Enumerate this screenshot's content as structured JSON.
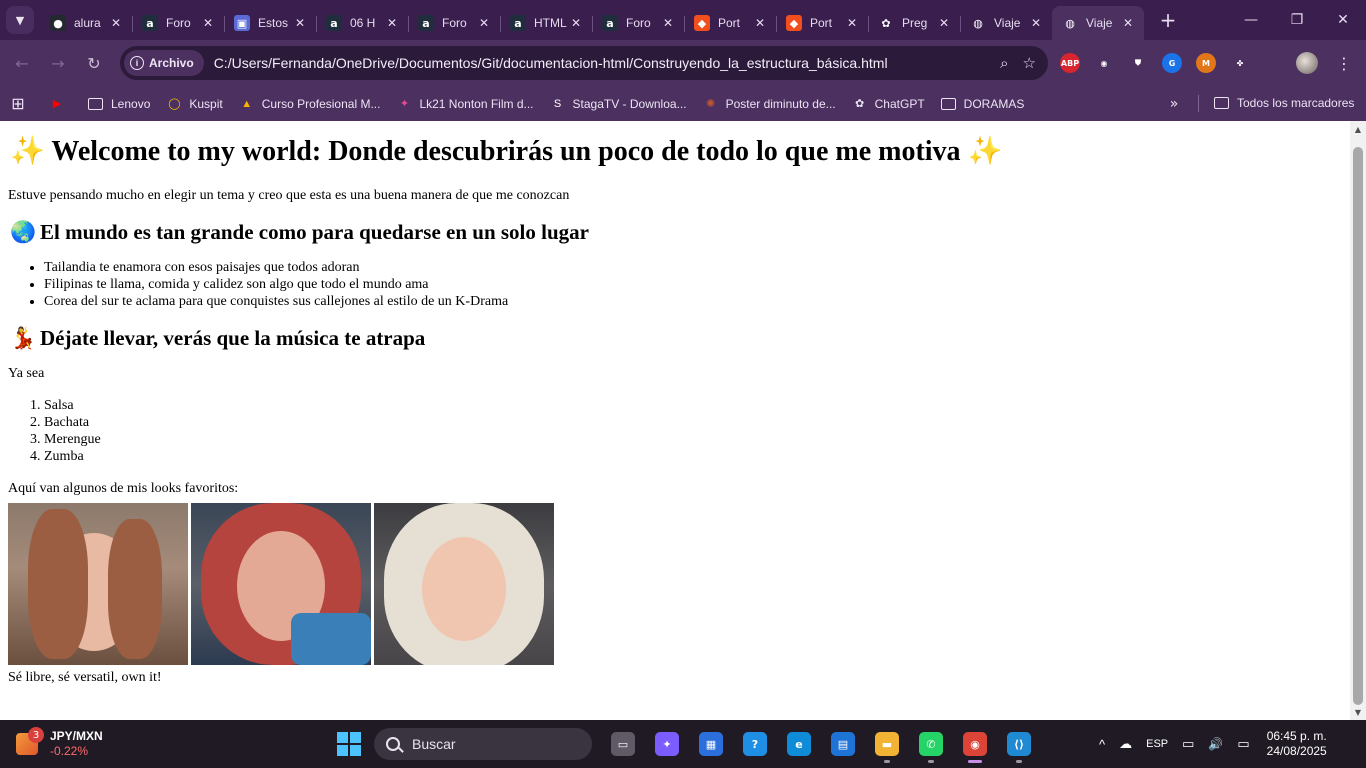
{
  "browser": {
    "tab_search_icon": "chevron-down-icon",
    "tabs": [
      {
        "title": "alura",
        "favicon": "github-icon",
        "color": "#24292f",
        "glyph": "●"
      },
      {
        "title": "Foro",
        "favicon": "alura-icon",
        "color": "#1f2d3d",
        "glyph": "a"
      },
      {
        "title": "Estos",
        "favicon": "image-icon",
        "color": "#5b6bd6",
        "glyph": "▣"
      },
      {
        "title": "06 H",
        "favicon": "alura-icon",
        "color": "#1f2d3d",
        "glyph": "a"
      },
      {
        "title": "Foro",
        "favicon": "alura-icon",
        "color": "#1f2d3d",
        "glyph": "a"
      },
      {
        "title": "HTML",
        "favicon": "alura-icon",
        "color": "#1f2d3d",
        "glyph": "a"
      },
      {
        "title": "Foro",
        "favicon": "alura-icon",
        "color": "#1f2d3d",
        "glyph": "a"
      },
      {
        "title": "Port",
        "favicon": "figma-icon",
        "color": "#f24e1e",
        "glyph": "◆"
      },
      {
        "title": "Port",
        "favicon": "figma-icon",
        "color": "#f24e1e",
        "glyph": "◆"
      },
      {
        "title": "Preg",
        "favicon": "chatgpt-icon",
        "color": "#3a1e4e",
        "glyph": "✿"
      },
      {
        "title": "Viaje",
        "favicon": "globe-icon",
        "color": "#3a1e4e",
        "glyph": "◍"
      },
      {
        "title": "Viaje",
        "favicon": "globe-icon",
        "color": "#4b3060",
        "glyph": "◍",
        "active": true
      }
    ],
    "close_glyph": "✕",
    "new_tab_glyph": "+",
    "window_controls": {
      "minimize": "—",
      "maximize": "❐",
      "close": "✕"
    },
    "nav": {
      "back": "←",
      "forward": "→",
      "reload": "↻"
    },
    "omnibox": {
      "chip_label": "Archivo",
      "chip_icon": "i",
      "url": "C:/Users/Fernanda/OneDrive/Documentos/Git/documentacion-html/Construyendo_la_estructura_básica.html",
      "zoom_glyph": "⌕",
      "bookmark_glyph": "☆"
    },
    "extensions": [
      {
        "name": "adblock-icon",
        "label": "ABP",
        "color": "#d7262e"
      },
      {
        "name": "mouse-icon",
        "label": "◉",
        "color": "#4b3060"
      },
      {
        "name": "shield-icon",
        "label": "⛊",
        "color": "#4b3060"
      },
      {
        "name": "google-lens-icon",
        "label": "G",
        "color": "#1a73e8"
      },
      {
        "name": "metamask-icon",
        "label": "M",
        "color": "#e2761b"
      },
      {
        "name": "puzzle-icon",
        "label": "✤",
        "color": "#4b3060"
      }
    ],
    "menu_glyph": "⋮"
  },
  "bookmarks": {
    "apps_glyph": "⊞",
    "items": [
      {
        "label": "",
        "icon": "youtube-icon",
        "glyph": "▶",
        "color": "#ff0000"
      },
      {
        "label": "Lenovo",
        "icon": "folder-icon",
        "folder": true
      },
      {
        "label": "Kuspit",
        "icon": "kuspit-icon",
        "glyph": "◯",
        "color": "#f0c000"
      },
      {
        "label": "Curso Profesional M...",
        "icon": "drive-icon",
        "glyph": "▲",
        "color": "#f7b400"
      },
      {
        "label": "Lk21 Nonton Film d...",
        "icon": "lk21-icon",
        "glyph": "✦",
        "color": "#e54b8a"
      },
      {
        "label": "StagaTV - Downloa...",
        "icon": "stagatv-icon",
        "glyph": "S",
        "color": "#ffffff"
      },
      {
        "label": "Poster diminuto de...",
        "icon": "poster-icon",
        "glyph": "✺",
        "color": "#c0552f"
      },
      {
        "label": "ChatGPT",
        "icon": "chatgpt-icon",
        "glyph": "✿",
        "color": "#ece4f3"
      },
      {
        "label": "DORAMAS",
        "icon": "folder-icon",
        "folder": true
      }
    ],
    "more_glyph": "»",
    "all_label": "Todos los marcadores"
  },
  "page": {
    "title_emoji": "✨",
    "title": "Welcome to my world: Donde descubrirás un poco de todo lo que me motiva",
    "intro": "Estuve pensando mucho en elegir un tema y creo que esta es una buena manera de que me conozcan",
    "section1_emoji": "🌏",
    "section1_title": "El mundo es tan grande como para quedarse en un solo lugar",
    "travel_list": [
      "Tailandia te enamora con esos paisajes que todos adoran",
      "Filipinas te llama, comida y calidez son algo que todo el mundo ama",
      "Corea del sur te aclama para que conquistes sus callejones al estilo de un K-Drama"
    ],
    "section2_emoji": "💃",
    "section2_title": "Déjate llevar, verás que la música te atrapa",
    "music_intro": "Ya sea",
    "music_list": [
      "Salsa",
      "Bachata",
      "Merengue",
      "Zumba"
    ],
    "looks_intro": "Aquí van algunos de mis looks favoritos:",
    "closing": "Sé libre, sé versatil, own it!"
  },
  "taskbar": {
    "widget": {
      "badge": "3",
      "title": "JPY/MXN",
      "value": "-0.22%"
    },
    "search_placeholder": "Buscar",
    "apps": [
      {
        "name": "task-view-icon",
        "glyph": "▭",
        "color": "#5f5a66"
      },
      {
        "name": "copilot-icon",
        "glyph": "✦",
        "color": "#7b5cff"
      },
      {
        "name": "store-icon",
        "glyph": "▦",
        "color": "#2a6fdb"
      },
      {
        "name": "help-icon",
        "glyph": "?",
        "color": "#1f8fe6"
      },
      {
        "name": "edge-icon",
        "glyph": "e",
        "color": "#0f8cd8"
      },
      {
        "name": "news-icon",
        "glyph": "▤",
        "color": "#1e73d6"
      },
      {
        "name": "file-explorer-icon",
        "glyph": "▬",
        "color": "#f2b233"
      },
      {
        "name": "whatsapp-icon",
        "glyph": "✆",
        "color": "#25d366"
      },
      {
        "name": "chrome-icon",
        "glyph": "◉",
        "color": "#db4437"
      },
      {
        "name": "vscode-icon",
        "glyph": "⟨⟩",
        "color": "#1f8ad2"
      }
    ],
    "tray": {
      "chevron": "^",
      "cloud": "☁",
      "language": "ESP",
      "network": "▭",
      "volume": "🔊",
      "battery": "▭",
      "time": "06:45 p. m.",
      "date": "24/08/2025"
    }
  }
}
